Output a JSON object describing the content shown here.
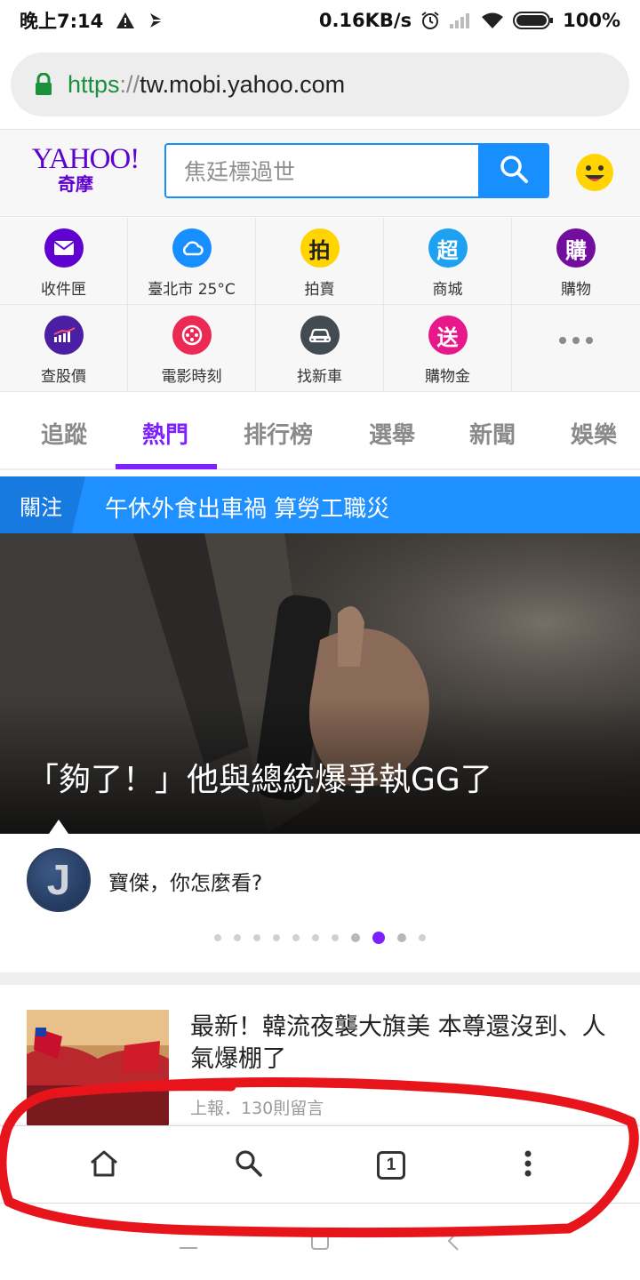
{
  "status_bar": {
    "time": "晚上7:14",
    "speed": "0.16KB/s",
    "battery": "100%"
  },
  "browser": {
    "url_scheme": "https",
    "url_sep": "://",
    "url_host": "tw.mobi.yahoo.com"
  },
  "header": {
    "logo_en": "YAHOO!",
    "logo_zh": "奇摩",
    "search_placeholder": "焦廷標過世"
  },
  "shortcuts": [
    {
      "label": "收件匣",
      "icon": "mail-icon",
      "color": "#5f01d1"
    },
    {
      "label": "臺北市 25°C",
      "icon": "weather-icon",
      "color": "#188fff"
    },
    {
      "label": "拍賣",
      "icon": "auction-icon",
      "glyph": "拍",
      "color": "#ffd400"
    },
    {
      "label": "商城",
      "icon": "mall-icon",
      "glyph": "超",
      "color": "#1ea1f1"
    },
    {
      "label": "購物",
      "icon": "shopping-icon",
      "glyph": "購",
      "color": "#720e9e"
    },
    {
      "label": "查股價",
      "icon": "stock-icon",
      "color": "#4b1fa3"
    },
    {
      "label": "電影時刻",
      "icon": "movie-icon",
      "color": "#ea2a55"
    },
    {
      "label": "找新車",
      "icon": "car-icon",
      "color": "#424a52"
    },
    {
      "label": "購物金",
      "icon": "voucher-icon",
      "glyph": "送",
      "color": "#e8178a"
    }
  ],
  "tabs": [
    "追蹤",
    "熱門",
    "排行榜",
    "選舉",
    "新聞",
    "娛樂"
  ],
  "active_tab": "熱門",
  "focus": {
    "tag": "關注",
    "headline": "午休外食出車禍 算勞工職災"
  },
  "hero": {
    "caption": "「夠了！」他與總統爆爭執GG了"
  },
  "comment": {
    "avatar_letter": "J",
    "prompt": "寶傑，你怎麼看?"
  },
  "carousel": {
    "total": 11,
    "active_index": 8
  },
  "news": {
    "title": "最新！韓流夜襲大旗美 本尊還沒到、人氣爆棚了",
    "meta": "上報．130則留言"
  },
  "toolbar": {
    "tab_count": "1"
  },
  "colors": {
    "yahoo_purple": "#5f01d1",
    "active_tab": "#7e1fff",
    "search_blue": "#188fff",
    "banner_blue": "#1e90ff",
    "annotation_red": "#e8141b"
  }
}
